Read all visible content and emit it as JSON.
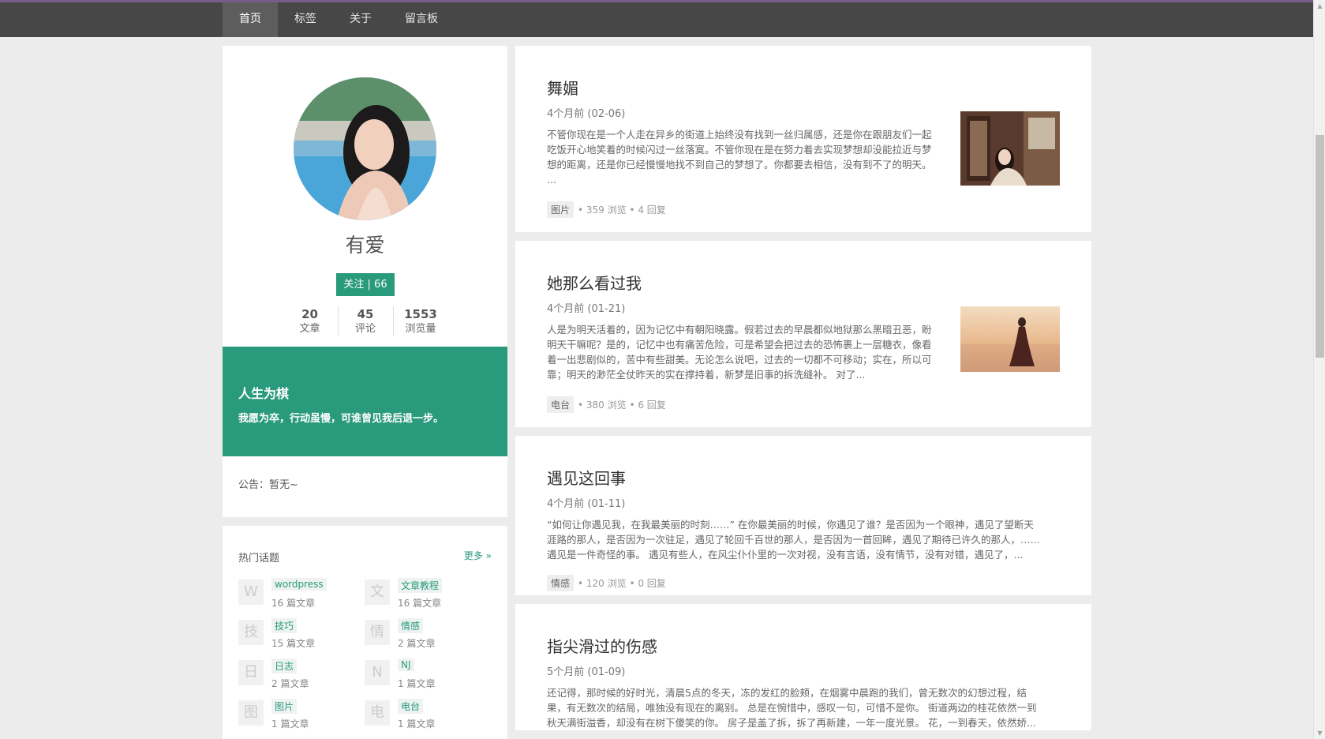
{
  "nav": {
    "items": [
      {
        "label": "首页",
        "active": true
      },
      {
        "label": "标签",
        "active": false
      },
      {
        "label": "关于",
        "active": false
      },
      {
        "label": "留言板",
        "active": false
      }
    ]
  },
  "profile": {
    "name": "有爱",
    "follow_label": "关注 | 66",
    "stats": [
      {
        "value": "20",
        "label": "文章"
      },
      {
        "value": "45",
        "label": "评论"
      },
      {
        "value": "1553",
        "label": "浏览量"
      }
    ],
    "motto_title": "人生为棋",
    "motto_text": "我愿为卒，行动虽慢，可谁曾见我后退一步。",
    "notice": "公告：暂无~"
  },
  "topics": {
    "title": "热门话题",
    "more_label": "更多 »",
    "items": [
      {
        "icon": "W",
        "name": "wordpress",
        "count": "16 篇文章"
      },
      {
        "icon": "文",
        "name": "文章教程",
        "count": "16 篇文章"
      },
      {
        "icon": "技",
        "name": "技巧",
        "count": "15 篇文章"
      },
      {
        "icon": "情",
        "name": "情感",
        "count": "2 篇文章"
      },
      {
        "icon": "日",
        "name": "日志",
        "count": "2 篇文章"
      },
      {
        "icon": "N",
        "name": "NJ",
        "count": "1 篇文章"
      },
      {
        "icon": "图",
        "name": "图片",
        "count": "1 篇文章"
      },
      {
        "icon": "电",
        "name": "电台",
        "count": "1 篇文章"
      }
    ]
  },
  "posts": [
    {
      "title": "舞媚",
      "date": "4个月前 (02-06)",
      "excerpt": [
        "不管你现在是一个人走在异乡的街道上始终没有找到一丝归属感，还是你在跟朋友们一起",
        "吃饭开心地笑着的时候闪过一丝落寞。不管你现在是在努力着去实现梦想却没能拉近与梦",
        "想的距离，还是你已经慢慢地找不到自己的梦想了。你都要去相信，没有到不了的明天。",
        "..."
      ],
      "tag": "图片",
      "stats": "• 359 浏览 • 4 回复"
    },
    {
      "title": "她那么看过我",
      "date": "4个月前 (01-21)",
      "excerpt": [
        "人是为明天活着的，因为记忆中有朝阳晓露。假若过去的早晨都似地狱那么黑暗丑恶，盼",
        "明天干嘛呢？是的，记忆中也有痛苦危险，可是希望会把过去的恐怖裹上一层糖衣，像看",
        "着一出悲剧似的，苦中有些甜美。无论怎么说吧，过去的一切都不可移动；实在，所以可",
        "靠；明天的渺茫全仗昨天的实在撑持着，新梦是旧事的拆洗缝补。 对了..."
      ],
      "tag": "电台",
      "stats": "• 380 浏览 • 6 回复"
    },
    {
      "title": "遇见这回事",
      "date": "4个月前 (01-11)",
      "excerpt": [
        "“如何让你遇见我，在我最美丽的时刻……” 在你最美丽的时候，你遇见了谁？是否因为一个眼神，遇见了望断天",
        "涯路的那人，是否因为一次驻足，遇见了轮回千百世的那人，是否因为一首回眸，遇见了期待已许久的那人，……",
        "遇见是一件奇怪的事。 遇见有些人，在风尘仆仆里的一次对视，没有言语，没有情节，没有对错，遇见了，..."
      ],
      "tag": "情感",
      "stats": "• 120 浏览 • 0 回复"
    },
    {
      "title": "指尖滑过的伤感",
      "date": "5个月前 (01-09)",
      "excerpt": [
        "还记得，那时候的好时光，清晨5点的冬天，冻的发红的脸颊，在烟雾中晨跑的我们，曾无数次的幻想过程，结",
        "果，有无数次的结局，唯独没有现在的离别。 总是在惋惜中，感叹一句，可惜不是你。 街道两边的桂花依然一到",
        "秋天满街溢香，却没有在树下傻笑的你。 房子是盖了拆，拆了再新建，一年一度光景。 花，一到春天，依然娇..."
      ],
      "tag": "",
      "stats": ""
    }
  ]
}
